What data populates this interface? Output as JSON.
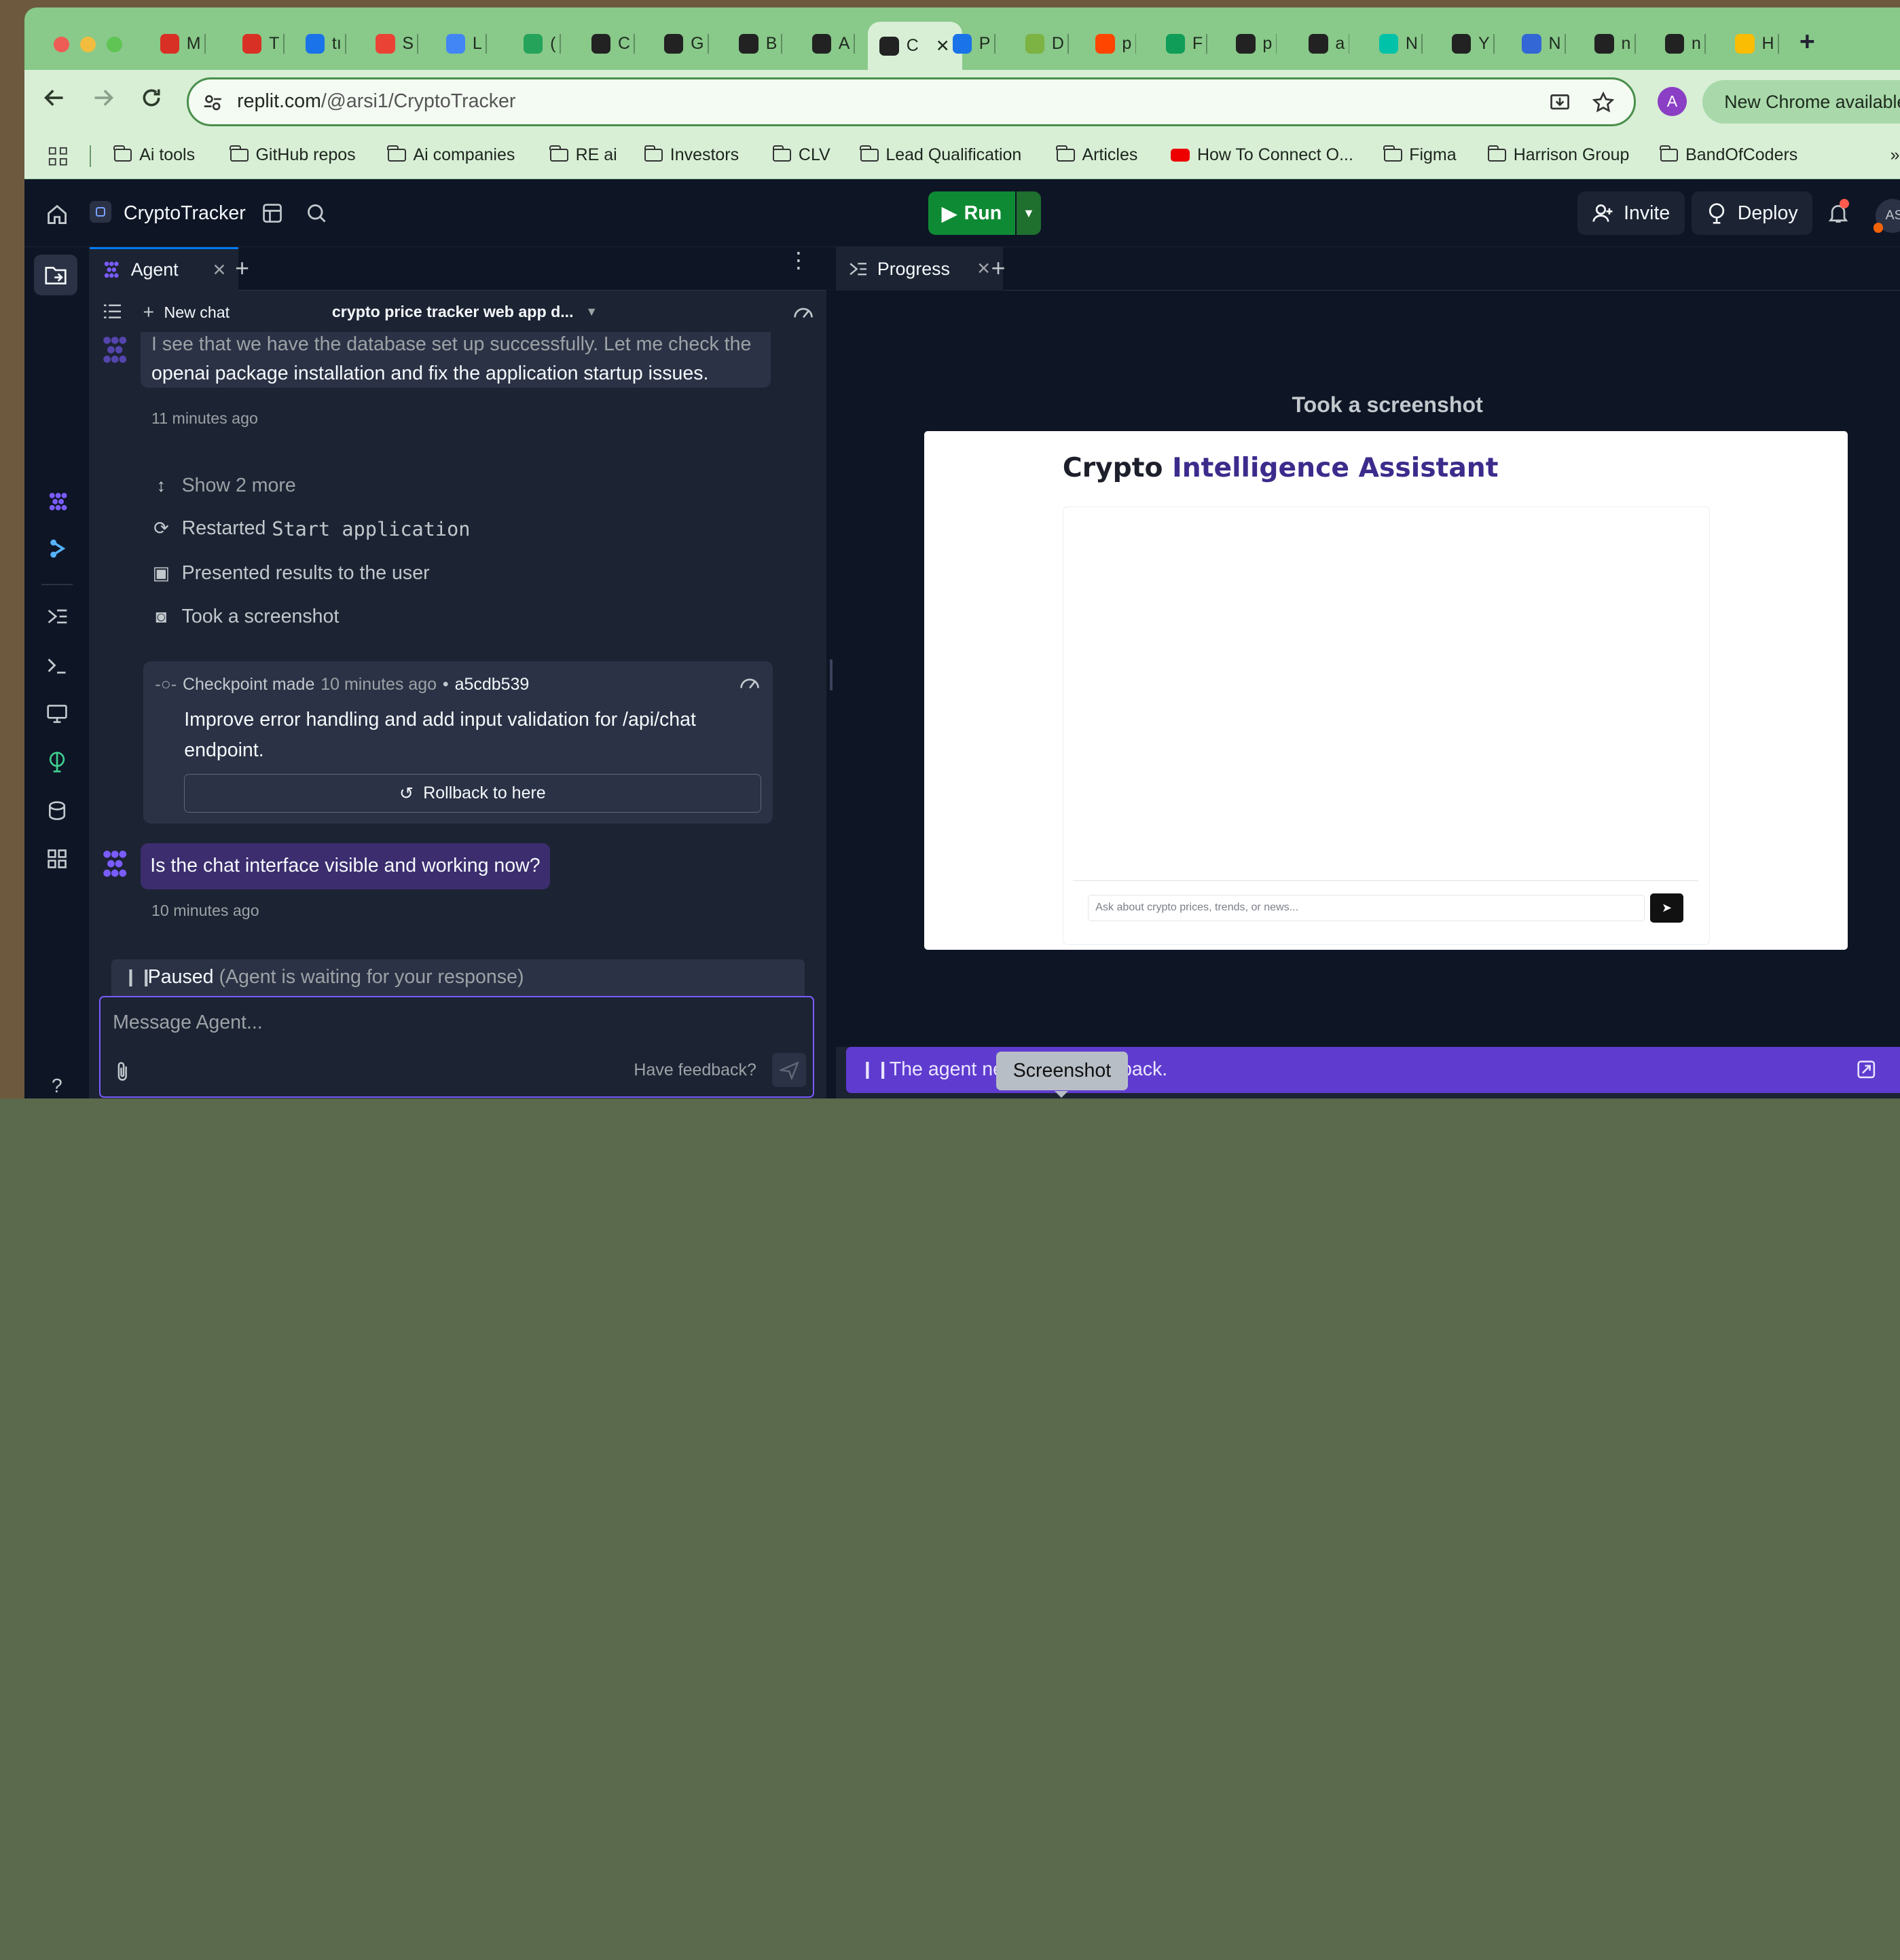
{
  "browser": {
    "tabs": [
      {
        "label": "M",
        "icon": "target-icon",
        "color": "#d93025"
      },
      {
        "label": "T",
        "icon": "target-icon",
        "color": "#d93025"
      },
      {
        "label": "tı",
        "icon": "cloud-icon",
        "color": "#1a73e8"
      },
      {
        "label": "S",
        "icon": "gmail-icon",
        "color": "#ea4335"
      },
      {
        "label": "L",
        "icon": "docs-icon",
        "color": "#4285f4"
      },
      {
        "label": "(",
        "icon": "chat-icon",
        "color": "#25a35a"
      },
      {
        "label": "C",
        "icon": "openai-icon",
        "color": "#222222"
      },
      {
        "label": "G",
        "icon": "github-icon",
        "color": "#222222"
      },
      {
        "label": "B",
        "icon": "pause-icon",
        "color": "#222222"
      },
      {
        "label": "A",
        "icon": "pause-icon",
        "color": "#222222"
      },
      {
        "label": "C",
        "icon": "replit-icon",
        "color": "#222222"
      },
      {
        "label": "P",
        "icon": "globe-icon",
        "color": "#1a73e8"
      },
      {
        "label": "D",
        "icon": "leaf-icon",
        "color": "#7cb342"
      },
      {
        "label": "p",
        "icon": "reddit-icon",
        "color": "#ff4500"
      },
      {
        "label": "F",
        "icon": "plus-square-icon",
        "color": "#0f9d58"
      },
      {
        "label": "p",
        "icon": "github-icon",
        "color": "#222222"
      },
      {
        "label": "a",
        "icon": "github-icon",
        "color": "#222222"
      },
      {
        "label": "N",
        "icon": "notion-icon",
        "color": "#00c2a8"
      },
      {
        "label": "Y",
        "icon": "swirl-icon",
        "color": "#222222"
      },
      {
        "label": "N",
        "icon": "n8n-icon",
        "color": "#3367d6"
      },
      {
        "label": "n",
        "icon": "crown-icon",
        "color": "#222222"
      },
      {
        "label": "n",
        "icon": "crown-icon",
        "color": "#222222"
      },
      {
        "label": "H",
        "icon": "drive-icon",
        "color": "#fbbc04"
      }
    ],
    "url_host": "replit.com",
    "url_path": "/@arsi1/CryptoTracker",
    "profile_initial": "A",
    "update_label": "New Chrome available",
    "bookmarks": [
      "Ai tools",
      "GitHub repos",
      "Ai companies",
      "RE ai",
      "Investors",
      "CLV",
      "Lead Qualification",
      "Articles",
      "How To Connect O...",
      "Figma",
      "Harrison Group",
      "BandOfCoders"
    ]
  },
  "replit": {
    "project_name": "CryptoTracker",
    "run_label": "Run",
    "invite_label": "Invite",
    "deploy_label": "Deploy",
    "user_initials": "AS"
  },
  "agent": {
    "tab_label": "Agent",
    "new_chat_label": "New chat",
    "chat_title": "crypto price tracker web app d...",
    "msg_line1": "I see that we have the database set up successfully. Let me check the",
    "msg_line2": "openai package installation and fix the application startup issues.",
    "msg_time": "11 minutes ago",
    "show_more": "Show 2 more",
    "restarted_prefix": "Restarted",
    "restarted_code": "Start application",
    "presented": "Presented results to the user",
    "took_screenshot": "Took a screenshot",
    "checkpoint_label": "Checkpoint made",
    "checkpoint_time": "10 minutes ago",
    "checkpoint_bullet": "•",
    "checkpoint_hash": "a5cdb539",
    "checkpoint_line1": "Improve error handling and add input validation for /api/chat",
    "checkpoint_line2": "endpoint.",
    "rollback_label": "Rollback to here",
    "user_question": "Is the chat interface visible and working now?",
    "question_time": "10 minutes ago",
    "paused_label": "Paused",
    "paused_note": "(Agent is waiting for your response)",
    "input_placeholder": "Message Agent...",
    "feedback_label": "Have feedback?"
  },
  "progress": {
    "tab_label": "Progress",
    "heading": "Took a screenshot",
    "shot_title_a": "Crypto ",
    "shot_title_b": "Intelligence Assistant",
    "shot_input_placeholder": "Ask about crypto prices, trends, or news...",
    "notice_a": "The agent need",
    "notice_b": "s your feedback.",
    "tooltip": "Screenshot"
  },
  "colors": {
    "brand_purple": "#5f3ccf",
    "run_green": "#0f8a34",
    "tab_green": "#89c98a"
  }
}
